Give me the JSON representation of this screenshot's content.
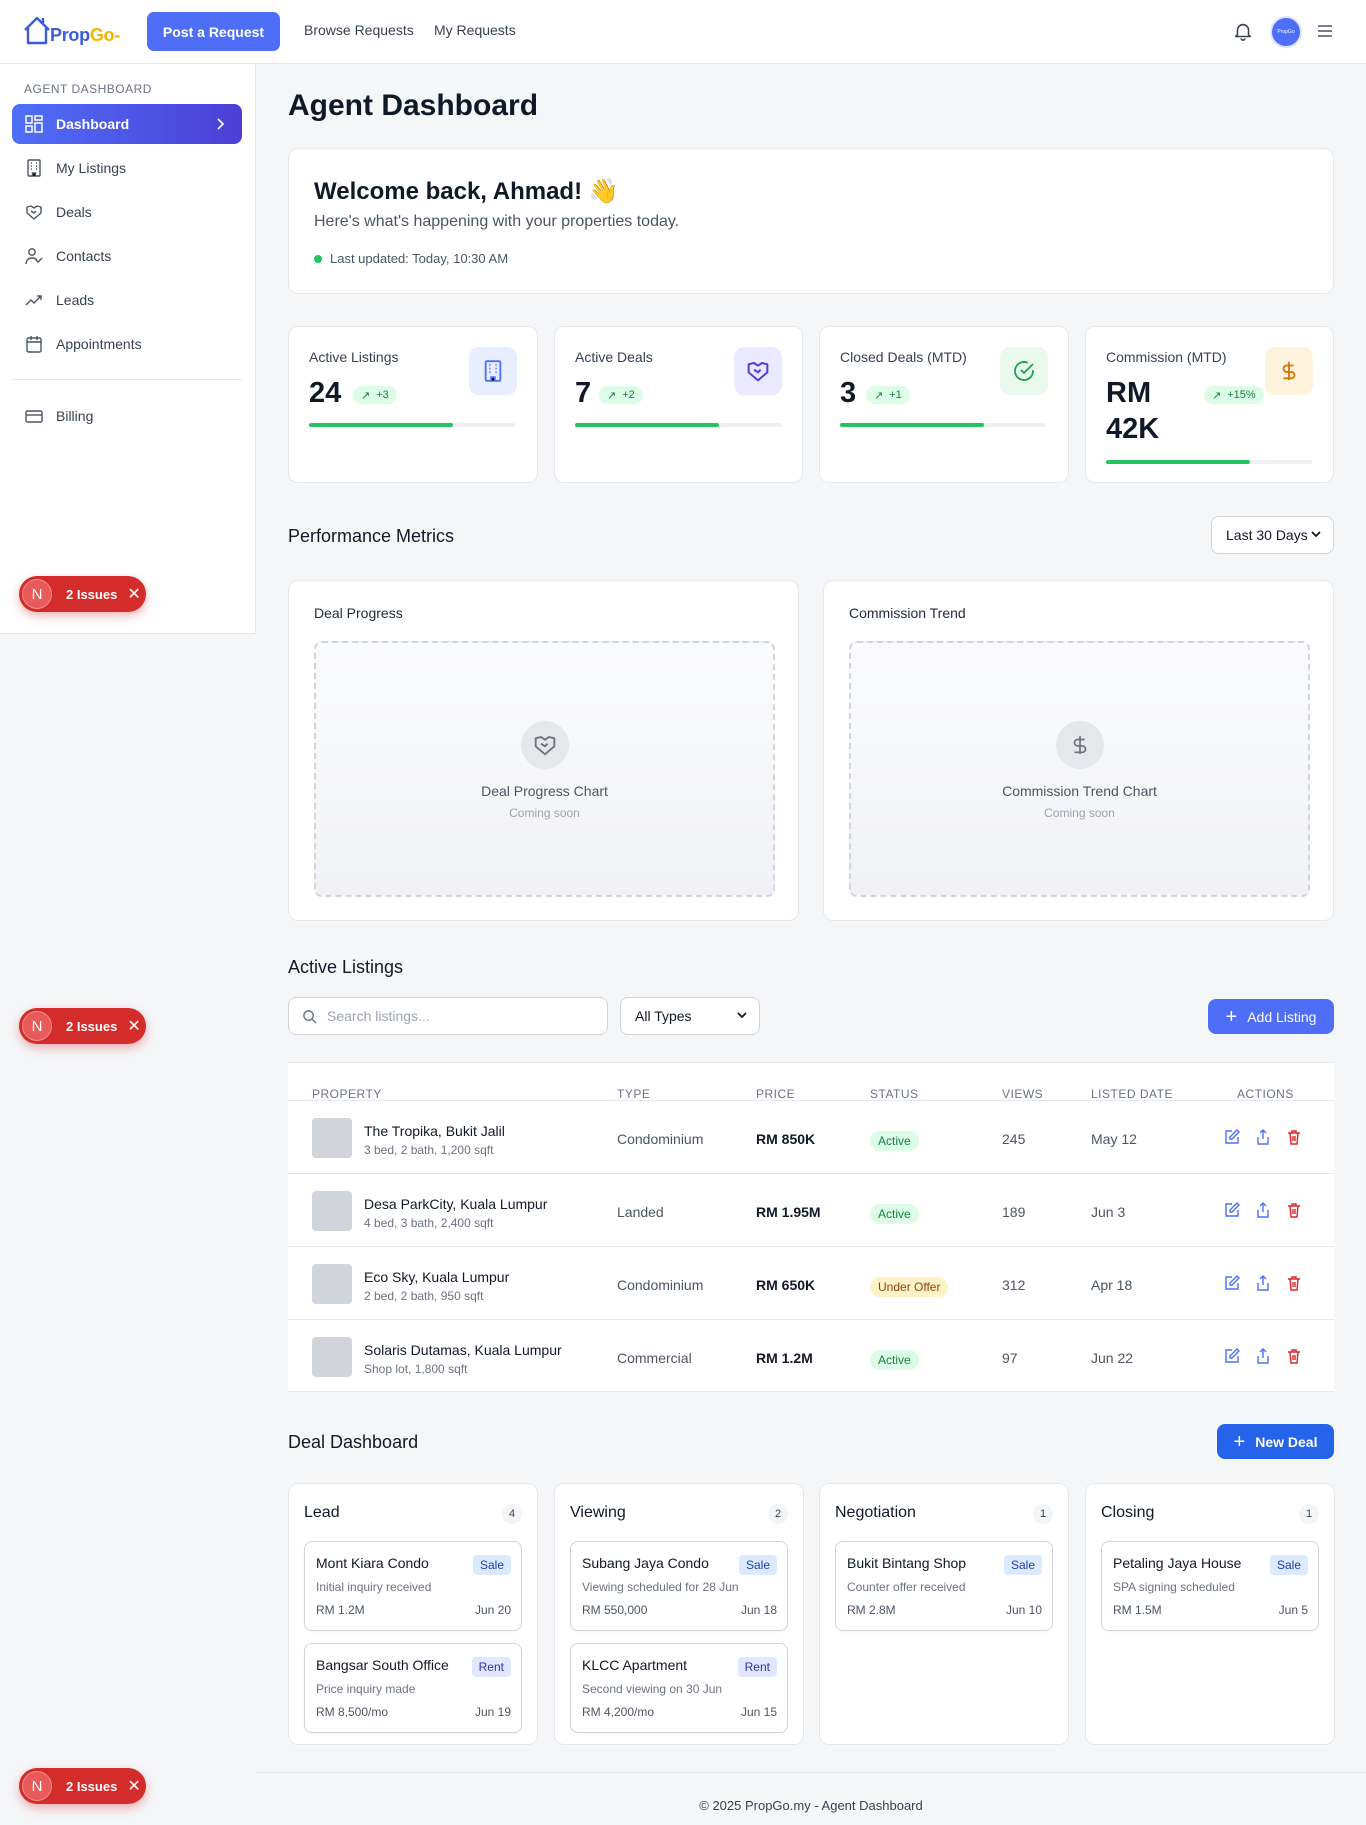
{
  "brand": {
    "logo_text_a": "Prop",
    "logo_text_b": "Go"
  },
  "topbar": {
    "post_request": "Post a Request",
    "nav": [
      "Browse Requests",
      "My Requests"
    ],
    "avatar_text": "PropGo"
  },
  "sidebar": {
    "heading": "AGENT DASHBOARD",
    "items": [
      {
        "label": "Dashboard",
        "icon": "dashboard-icon"
      },
      {
        "label": "My Listings",
        "icon": "building-icon"
      },
      {
        "label": "Deals",
        "icon": "handshake-icon"
      },
      {
        "label": "Contacts",
        "icon": "user-check-icon"
      },
      {
        "label": "Leads",
        "icon": "trending-up-icon"
      },
      {
        "label": "Appointments",
        "icon": "calendar-icon"
      },
      {
        "label": "Billing",
        "icon": "credit-card-icon"
      }
    ]
  },
  "issues_badge": {
    "letter": "N",
    "label": "2 Issues"
  },
  "page": {
    "title": "Agent Dashboard"
  },
  "welcome": {
    "title": "Welcome back, Ahmad! 👋",
    "subtitle": "Here's what's happening with your properties today.",
    "updated": "Last updated: Today, 10:30 AM"
  },
  "stats": [
    {
      "label": "Active Listings",
      "value": "24",
      "change": "+3",
      "progress": 0.7,
      "icon": "building-icon",
      "color": "#4f6ef7"
    },
    {
      "label": "Active Deals",
      "value": "7",
      "change": "+2",
      "progress": 0.7,
      "icon": "handshake-icon",
      "color": "#4c3fd6"
    },
    {
      "label": "Closed Deals (MTD)",
      "value": "3",
      "change": "+1",
      "progress": 0.7,
      "icon": "check-circle-icon",
      "color": "#16a34a"
    },
    {
      "label": "Commission (MTD)",
      "value_line1": "RM",
      "value_line2": "42K",
      "change": "+15%",
      "progress": 0.7,
      "icon": "dollar-icon",
      "color": "#d97706"
    }
  ],
  "performance": {
    "title": "Performance Metrics",
    "range": "Last 30 Days",
    "charts": [
      {
        "title": "Deal Progress",
        "placeholder": "Deal Progress Chart",
        "note": "Coming soon",
        "icon": "handshake-icon"
      },
      {
        "title": "Commission Trend",
        "placeholder": "Commission Trend Chart",
        "note": "Coming soon",
        "icon": "dollar-icon"
      }
    ]
  },
  "listings": {
    "title": "Active Listings",
    "search_placeholder": "Search listings...",
    "type_filter": "All Types",
    "add_label": "Add Listing",
    "columns": [
      "PROPERTY",
      "TYPE",
      "PRICE",
      "STATUS",
      "VIEWS",
      "LISTED DATE",
      "ACTIONS"
    ],
    "rows": [
      {
        "name": "The Tropika, Bukit Jalil",
        "desc": "3 bed, 2 bath, 1,200 sqft",
        "type": "Condominium",
        "price": "RM 850K",
        "status": "Active",
        "views": "245",
        "date": "May 12"
      },
      {
        "name": "Desa ParkCity, Kuala Lumpur",
        "desc": "4 bed, 3 bath, 2,400 sqft",
        "type": "Landed",
        "price": "RM 1.95M",
        "status": "Active",
        "views": "189",
        "date": "Jun 3"
      },
      {
        "name": "Eco Sky, Kuala Lumpur",
        "desc": "2 bed, 2 bath, 950 sqft",
        "type": "Condominium",
        "price": "RM 650K",
        "status": "Under Offer",
        "views": "312",
        "date": "Apr 18"
      },
      {
        "name": "Solaris Dutamas, Kuala Lumpur",
        "desc": "Shop lot, 1,800 sqft",
        "type": "Commercial",
        "price": "RM 1.2M",
        "status": "Active",
        "views": "97",
        "date": "Jun 22"
      }
    ]
  },
  "deals": {
    "title": "Deal Dashboard",
    "new_label": "New Deal",
    "columns": [
      {
        "name": "Lead",
        "count": "4",
        "cards": [
          {
            "name": "Mont Kiara Condo",
            "tag": "Sale",
            "desc": "Initial inquiry received",
            "price": "RM 1.2M",
            "date": "Jun 20"
          },
          {
            "name": "Bangsar South Office",
            "tag": "Rent",
            "desc": "Price inquiry made",
            "price": "RM 8,500/mo",
            "date": "Jun 19"
          }
        ]
      },
      {
        "name": "Viewing",
        "count": "2",
        "cards": [
          {
            "name": "Subang Jaya Condo",
            "tag": "Sale",
            "desc": "Viewing scheduled for 28 Jun",
            "price": "RM 550,000",
            "date": "Jun 18"
          },
          {
            "name": "KLCC Apartment",
            "tag": "Rent",
            "desc": "Second viewing on 30 Jun",
            "price": "RM 4,200/mo",
            "date": "Jun 15"
          }
        ]
      },
      {
        "name": "Negotiation",
        "count": "1",
        "cards": [
          {
            "name": "Bukit Bintang Shop",
            "tag": "Sale",
            "desc": "Counter offer received",
            "price": "RM 2.8M",
            "date": "Jun 10"
          }
        ]
      },
      {
        "name": "Closing",
        "count": "1",
        "cards": [
          {
            "name": "Petaling Jaya House",
            "tag": "Sale",
            "desc": "SPA signing scheduled",
            "price": "RM 1.5M",
            "date": "Jun 5"
          }
        ]
      }
    ]
  },
  "footer": {
    "text": "© 2025 PropGo.my - Agent Dashboard"
  }
}
